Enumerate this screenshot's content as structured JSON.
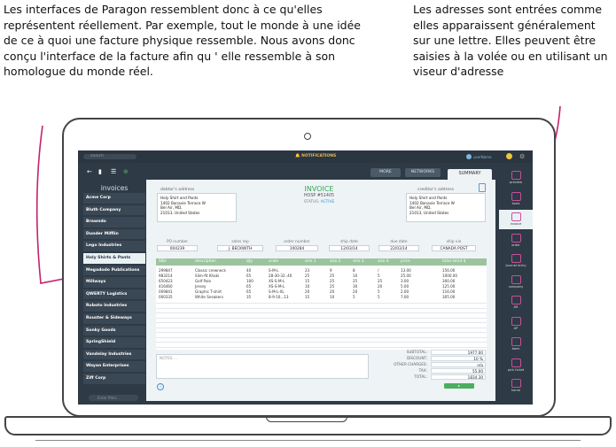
{
  "annotations": {
    "left": "Les interfaces de Paragon ressemblent donc à ce qu'elles représentent réellement. Par exemple, tout le monde à une idée de ce à quoi une facture physique ressemble. Nous avons donc conçu l'interface de la facture afin qu ' elle ressemble à son homologue du monde réel.",
    "right": "Les adresses sont entrées comme elles apparaissent généralement sur une lettre. Elles peuvent être saisies à la volée ou en utilisant un viseur d'adresse"
  },
  "topbar": {
    "search_placeholder": "search",
    "notifications": "NOTIFICATIONS",
    "user": "userName"
  },
  "sidebar": {
    "title": "invoices",
    "tool_icons": [
      "back-arrow-icon",
      "chart-icon",
      "list-icon",
      "add-icon"
    ],
    "clients": [
      "Acme Corp",
      "Bluth Company",
      "Brawndo",
      "Dunder Mifflin",
      "Lego Industries",
      "Holy Shirts & Pants",
      "Megadodo Publications",
      "Millways",
      "QWERTY Logistics",
      "Roboto Industries",
      "Rouster & Sideways",
      "Sonky Goods",
      "SpringShield",
      "Vandelay Industries",
      "Wayan Enterprises",
      "Ziff Corp"
    ],
    "selected": "Holy Shirts & Pants",
    "filter_placeholder": "Enter filter..."
  },
  "tabs": [
    "MORE",
    "NETWORKS",
    "SUMMARY"
  ],
  "invoice": {
    "title": "INVOICE",
    "number": "HOSP #51405",
    "status_label": "STATUS:",
    "status": "ACTIVE",
    "debtor_label": "debtor's address",
    "debtor_lines": [
      "Holy Shirt and Pants",
      "1402 Banavie Terrace W",
      "Bel Air, MD,",
      "21013, United States"
    ],
    "creditor_label": "creditor's address",
    "creditor_lines": [
      "Holy Shirt and Pants",
      "1402 Banavie Terrace W",
      "Bel Air, MD,",
      "21013, United States"
    ],
    "fields": [
      {
        "label": "PO number",
        "value": "004239"
      },
      {
        "label": "sales rep",
        "value": "J. BECKWITH"
      },
      {
        "label": "order number",
        "value": "100284"
      },
      {
        "label": "ship date",
        "value": "12/03/14"
      },
      {
        "label": "due date",
        "value": "22/03/14"
      },
      {
        "label": "ship via",
        "value": "CANADA POST"
      }
    ],
    "columns": [
      "SKU",
      "description",
      "qty",
      "scale",
      "size 1",
      "size 2",
      "size 3",
      "size 4",
      "price",
      "total amnt $"
    ],
    "rows": [
      [
        "299847",
        "Classic crewneck",
        "40",
        "S-M-L",
        "23",
        "9",
        "8",
        "/",
        "13.00",
        "156.00"
      ],
      [
        "983214",
        "Slim-fit Khaki",
        "65",
        "28-30-32..40",
        "25",
        "25",
        "10",
        "5",
        "25.00",
        "1000.00"
      ],
      [
        "650423",
        "Golf Polo",
        "100",
        "XS-S-M-L",
        "15",
        "25",
        "25",
        "25",
        "3.00",
        "300.00"
      ],
      [
        "416460",
        "Jersey",
        "65",
        "XS-S-M-L",
        "10",
        "25",
        "30",
        "20",
        "5.00",
        "125.00"
      ],
      [
        "009841",
        "Graphic T-shirt",
        "65",
        "S-M-L-XL",
        "20",
        "20",
        "20",
        "5",
        "2.00",
        "116.00"
      ],
      [
        "000335",
        "White Sneakers",
        "35",
        "8-9-10...13",
        "15",
        "10",
        "5",
        "5",
        "7.00",
        "305.00"
      ]
    ],
    "notes_placeholder": "NOTES ...",
    "totals": [
      {
        "label": "SUBTOTAL:",
        "value": "1977.00"
      },
      {
        "label": "DISCOUNT:",
        "value": "10 %"
      },
      {
        "label": "OTHER CHARGES:",
        "value": "n/a"
      },
      {
        "label": "TAX:",
        "value": "55.00"
      },
      {
        "label": "TOTAL:",
        "value": "1834.30"
      }
    ]
  },
  "rail": [
    "preview",
    "tools",
    "invoice",
    "order",
    "journal entry",
    "company",
    "AR",
    "AP",
    "bank",
    "pick ticket",
    "home"
  ],
  "rail_active": "invoice"
}
